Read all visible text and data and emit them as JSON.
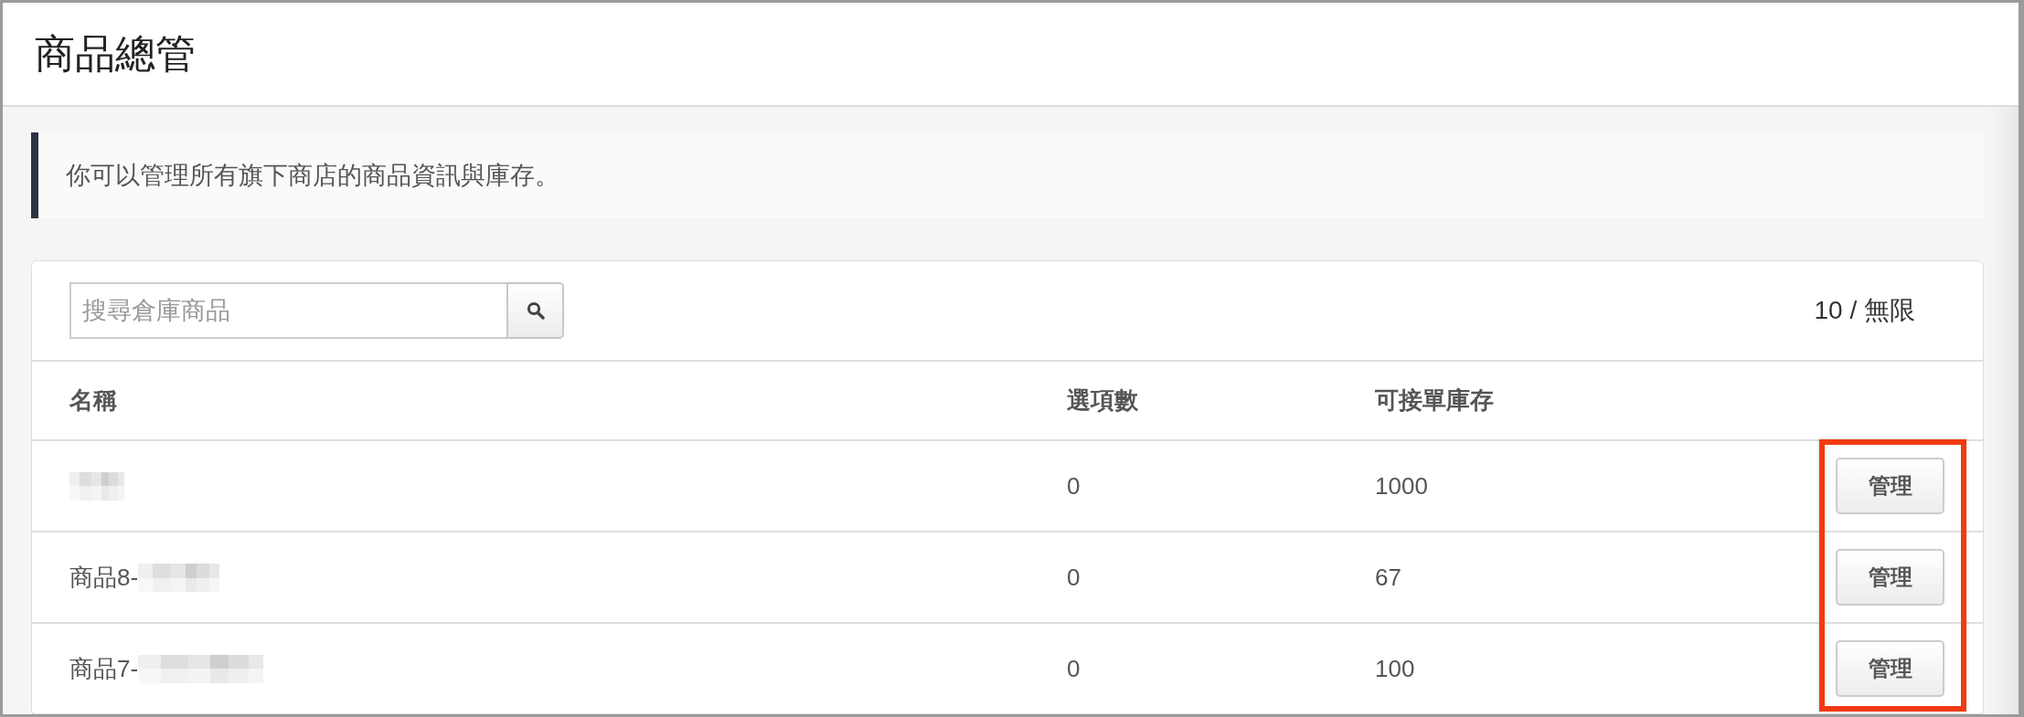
{
  "page": {
    "title": "商品總管"
  },
  "notice": {
    "text": "你可以管理所有旗下商店的商品資訊與庫存。"
  },
  "search": {
    "placeholder": "搜尋倉庫商品"
  },
  "quota": "10 / 無限",
  "table": {
    "columns": [
      "名稱",
      "選項數",
      "可接單庫存"
    ],
    "action_column_highlighted": true,
    "rows": [
      {
        "redacted": true,
        "options": "0",
        "stock": "1000",
        "action": "管理"
      },
      {
        "name": "商品8-",
        "redacted": true,
        "options": "0",
        "stock": "67",
        "action": "管理"
      },
      {
        "name": "商品7-",
        "redacted": true,
        "options": "0",
        "stock": "100",
        "action": "管理"
      }
    ]
  }
}
